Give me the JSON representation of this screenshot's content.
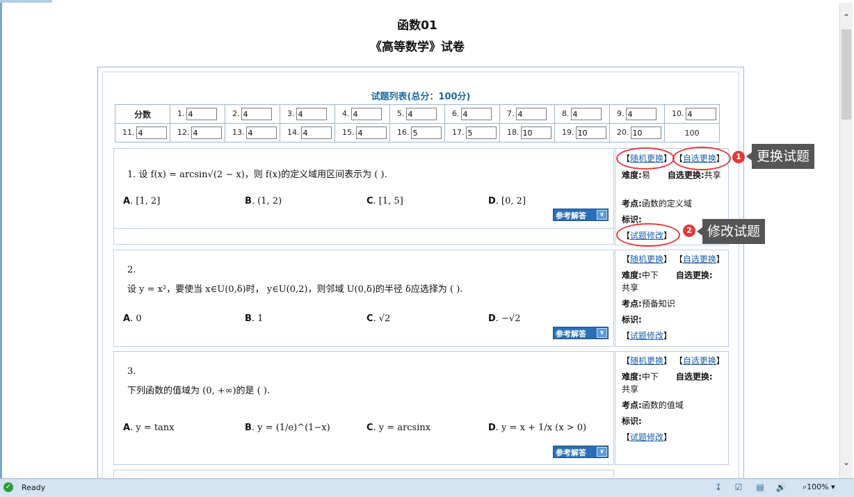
{
  "page": {
    "title": "函数01",
    "subtitle": "《高等数学》试卷"
  },
  "score_table": {
    "title": "试题列表(总分：100分)",
    "label": "分数",
    "row1": [
      {
        "n": "1.",
        "v": "4"
      },
      {
        "n": "2.",
        "v": "4"
      },
      {
        "n": "3.",
        "v": "4"
      },
      {
        "n": "4.",
        "v": "4"
      },
      {
        "n": "5.",
        "v": "4"
      },
      {
        "n": "6.",
        "v": "4"
      },
      {
        "n": "7.",
        "v": "4"
      },
      {
        "n": "8.",
        "v": "4"
      },
      {
        "n": "9.",
        "v": "4"
      },
      {
        "n": "10.",
        "v": "4"
      }
    ],
    "row2": [
      {
        "n": "11.",
        "v": "4"
      },
      {
        "n": "12.",
        "v": "4"
      },
      {
        "n": "13.",
        "v": "4"
      },
      {
        "n": "14.",
        "v": "4"
      },
      {
        "n": "15.",
        "v": "4"
      },
      {
        "n": "16.",
        "v": "5"
      },
      {
        "n": "17.",
        "v": "5"
      },
      {
        "n": "18.",
        "v": "10"
      },
      {
        "n": "19.",
        "v": "10"
      },
      {
        "n": "20.",
        "v": "10"
      }
    ],
    "total": "100"
  },
  "questions": [
    {
      "text": "1.  设 f(x) = arcsin√(2 − x)，则 f(x)的定义域用区间表示为 ( ).",
      "options": [
        {
          "letter": "A",
          "value": ". [1, 2]"
        },
        {
          "letter": "B",
          "value": ". (1, 2)"
        },
        {
          "letter": "C",
          "value": ". [1, 5]"
        },
        {
          "letter": "D",
          "value": ". [0, 2]"
        }
      ],
      "answer_btn": "参考解答",
      "random_change": "随机更换",
      "self_change": "自选更换",
      "difficulty_label": "难度:",
      "difficulty": "易",
      "self_change_label": "自选更换:",
      "share": "共享",
      "point_label": "考点:",
      "point": "函数的定义域",
      "mark_label": "标识:",
      "edit": "试题修改"
    },
    {
      "number": "2.",
      "text": "设 y = x²，要使当 x∈U(0,δ)时， y∈U(0,2)，则邻域 U(0,δ)的半径 δ应选择为 ( ).",
      "options": [
        {
          "letter": "A",
          "value": ". 0"
        },
        {
          "letter": "B",
          "value": ". 1"
        },
        {
          "letter": "C",
          "value": ". √2"
        },
        {
          "letter": "D",
          "value": ". −√2"
        }
      ],
      "answer_btn": "参考解答",
      "random_change": "随机更换",
      "self_change": "自选更换",
      "difficulty_label": "难度:",
      "difficulty": "中下",
      "self_change_label": "自选更换:",
      "share": "共享",
      "point_label": "考点:",
      "point": "预备知识",
      "mark_label": "标识:",
      "edit": "试题修改"
    },
    {
      "number": "3.",
      "text": "下列函数的值域为 (0, +∞)的是 ( ).",
      "options": [
        {
          "letter": "A",
          "value": ". y = tanx"
        },
        {
          "letter": "B",
          "value": ". y = (1/e)^(1−x)"
        },
        {
          "letter": "C",
          "value": ". y = arcsinx"
        },
        {
          "letter": "D",
          "value": ". y = x + 1/x (x > 0)"
        }
      ],
      "answer_btn": "参考解答",
      "random_change": "随机更换",
      "self_change": "自选更换",
      "difficulty_label": "难度:",
      "difficulty": "中下",
      "self_change_label": "自选更换:",
      "share": "共享",
      "point_label": "考点:",
      "point": "函数的值域",
      "mark_label": "标识:",
      "edit": "试题修改"
    }
  ],
  "annotations": [
    {
      "badge": "1",
      "text": "更换试题"
    },
    {
      "badge": "2",
      "text": "修改试题"
    }
  ],
  "statusbar": {
    "status": "Ready",
    "zoom": "100%"
  },
  "icons": {
    "ready": "check-circle-icon",
    "download": "download-icon",
    "speaker": "speaker-icon",
    "zoom": "zoom-icon"
  },
  "colors": {
    "accent": "#1a6aa0",
    "annotation_red": "#e23b3b",
    "callout_bg": "#555555",
    "status_bg": "#d4e4f3"
  }
}
